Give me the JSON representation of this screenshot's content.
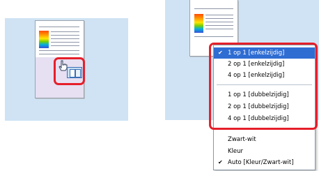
{
  "left_panel": {
    "document": "document-preview",
    "icon": "pointing-hand-icon"
  },
  "right_panel": {
    "menu_items": [
      {
        "label": "1 op 1 [enkelzijdig]",
        "checked": true,
        "selected": true
      },
      {
        "label": "2 op 1 [enkelzijdig]",
        "checked": false,
        "selected": false
      },
      {
        "label": "4 op 1 [enkelzijdig]",
        "checked": false,
        "selected": false
      },
      {
        "label": "1 op 1 [dubbelzijdig]",
        "checked": false,
        "selected": false
      },
      {
        "label": "2 op 1 [dubbelzijdig]",
        "checked": false,
        "selected": false
      },
      {
        "label": "4 op 1 [dubbelzijdig]",
        "checked": false,
        "selected": false
      },
      {
        "label": "Zwart-wit",
        "checked": false,
        "selected": false
      },
      {
        "label": "Kleur",
        "checked": false,
        "selected": false
      },
      {
        "label": "Auto [Kleur/Zwart-wit]",
        "checked": true,
        "selected": false
      }
    ],
    "check_mark": "✔"
  },
  "colors": {
    "panel_bg": "#cfe3f4",
    "highlight_border": "#e51f2a",
    "selection_bg": "#2f6dd3"
  }
}
